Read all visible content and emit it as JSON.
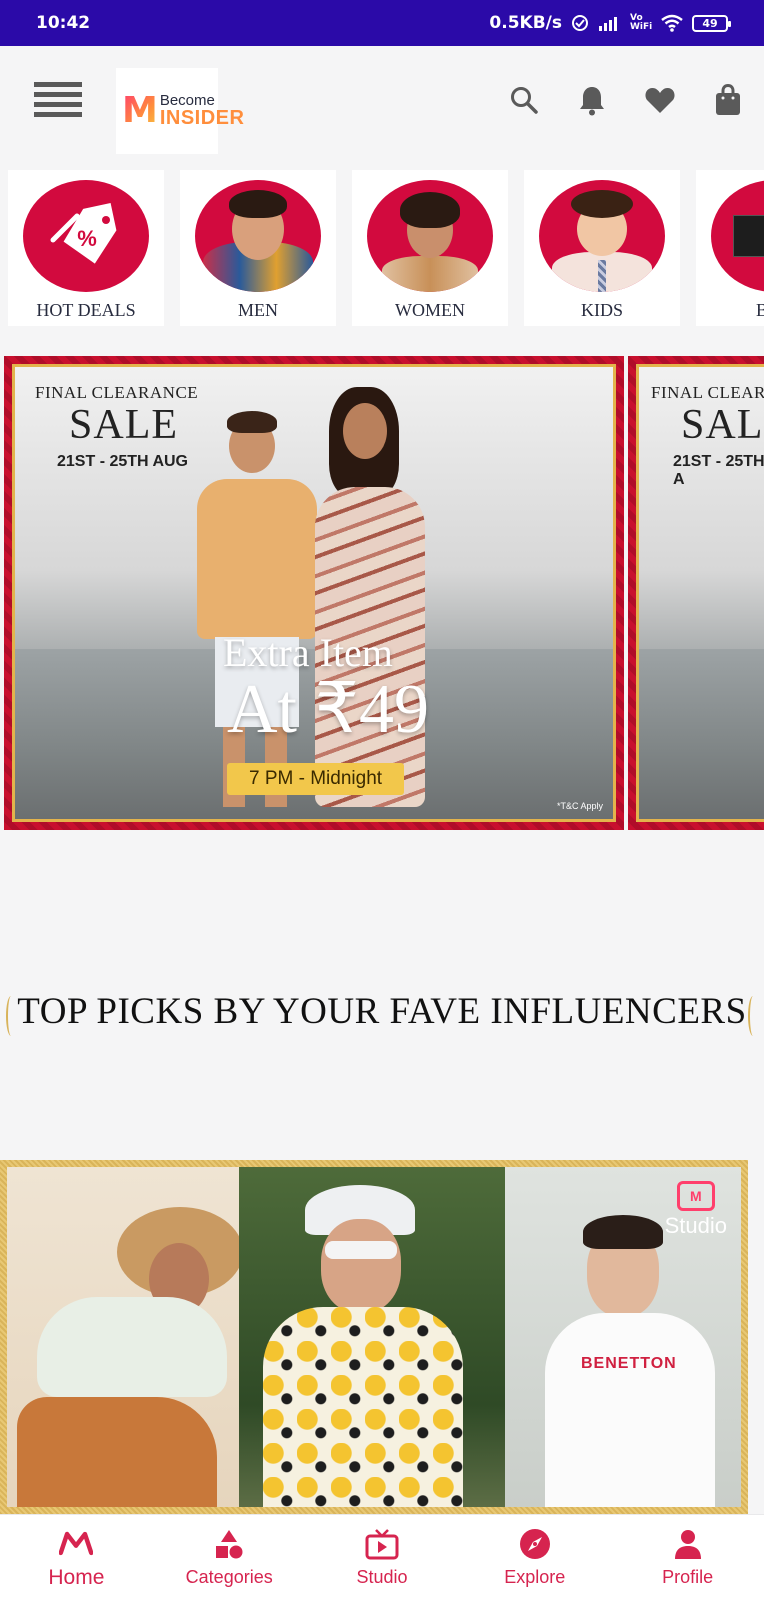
{
  "status_bar": {
    "time": "10:42",
    "net_speed": "0.5KB/s",
    "vowifi": "Vo WiFi",
    "battery": "49"
  },
  "header": {
    "logo_top": "Become",
    "logo_bottom": "INSIDER",
    "icons": [
      "search-icon",
      "bell-icon",
      "heart-icon",
      "bag-icon"
    ]
  },
  "categories": [
    {
      "label": "HOT DEALS"
    },
    {
      "label": "MEN"
    },
    {
      "label": "WOMEN"
    },
    {
      "label": "KIDS"
    },
    {
      "label": "BEA"
    }
  ],
  "banners": [
    {
      "kicker": "FINAL CLEARANCE",
      "title": "SALE",
      "dates": "21ST - 25TH AUG",
      "headline": "Extra Item",
      "price": "At ₹49",
      "time": "7 PM - Midnight",
      "tnc": "*T&C Apply"
    },
    {
      "kicker": "FINAL CLEAR",
      "title": "SALE",
      "dates": "21ST - 25TH A"
    }
  ],
  "section_title": "TOP PICKS BY YOUR FAVE INFLUENCERS",
  "influencer": {
    "badge": "Studio",
    "shirt_text": "BENETTON"
  },
  "bottom_nav": [
    {
      "label": "Home",
      "icon": "myntra-logo-icon",
      "active": true
    },
    {
      "label": "Categories",
      "icon": "shapes-icon",
      "active": false
    },
    {
      "label": "Studio",
      "icon": "tv-icon",
      "active": false
    },
    {
      "label": "Explore",
      "icon": "compass-icon",
      "active": false
    },
    {
      "label": "Profile",
      "icon": "person-icon",
      "active": false
    }
  ],
  "colors": {
    "status_bar": "#2b0aa8",
    "accent": "#d6244f",
    "banner_red": "#c8102e",
    "gold": "#e3b44c"
  }
}
